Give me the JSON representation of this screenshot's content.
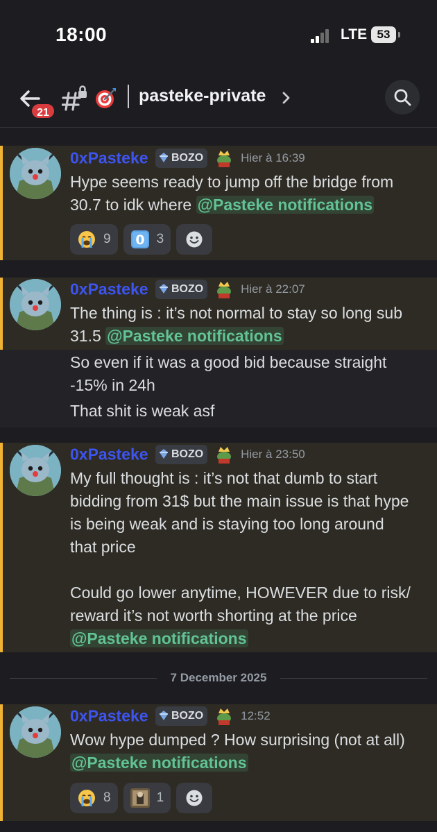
{
  "status_bar": {
    "time": "18:00",
    "network": "LTE",
    "battery": "53"
  },
  "header": {
    "back_badge": "21",
    "channel_name": "pasteke-private",
    "icons": [
      "back-arrow-icon",
      "locked-channel-hash-icon",
      "target-dart-icon",
      "chevron-right-icon",
      "search-icon"
    ]
  },
  "colors": {
    "accent": "#f0b232",
    "username": "#3d54f0",
    "mention": "#62c395",
    "badge": "#d83c3e",
    "highlight_bg": "#2e2b24"
  },
  "messages": [
    {
      "author": "0xPasteke",
      "tag": "BOZO",
      "timestamp": "Hier à 16:39",
      "lines": [
        "Hype seems ready to jump off the bridge from",
        "30.7 to idk where"
      ],
      "mention": "@Pasteke notifications",
      "reactions": [
        {
          "emoji": "loudly-crying-face-icon",
          "count": "9"
        },
        {
          "emoji": "keycap-zero-icon",
          "count": "3"
        },
        {
          "emoji": "add-reaction-icon",
          "count": ""
        }
      ]
    },
    {
      "author": "0xPasteke",
      "tag": "BOZO",
      "timestamp": "Hier à 22:07",
      "lines": [
        "The thing is : it’s not normal to stay so long sub",
        "31.5"
      ],
      "mention": "@Pasteke notifications",
      "followups": [
        "So even if it was a good bid because straight",
        "-15% in 24h",
        "That shit is weak asf"
      ]
    },
    {
      "author": "0xPasteke",
      "tag": "BOZO",
      "timestamp": "Hier à 23:50",
      "lines": [
        "My full thought is : it’s not that dumb to start",
        "bidding from 31$ but the main issue is that hype",
        "is being weak and is staying too long around",
        "that price",
        "",
        "Could go lower anytime, HOWEVER due to risk/",
        "reward it’s not worth shorting at the price"
      ],
      "mention": "@Pasteke notifications"
    },
    {
      "author": "0xPasteke",
      "tag": "BOZO",
      "timestamp": "12:52",
      "lines": [
        "Wow hype dumped ? How surprising (not at all)"
      ],
      "mention": "@Pasteke notifications",
      "reactions": [
        {
          "emoji": "loudly-crying-face-icon",
          "count": "8"
        },
        {
          "emoji": "custom-image-emoji-icon",
          "count": "1"
        },
        {
          "emoji": "add-reaction-icon",
          "count": ""
        }
      ]
    }
  ],
  "date_separator": "7 December 2025"
}
